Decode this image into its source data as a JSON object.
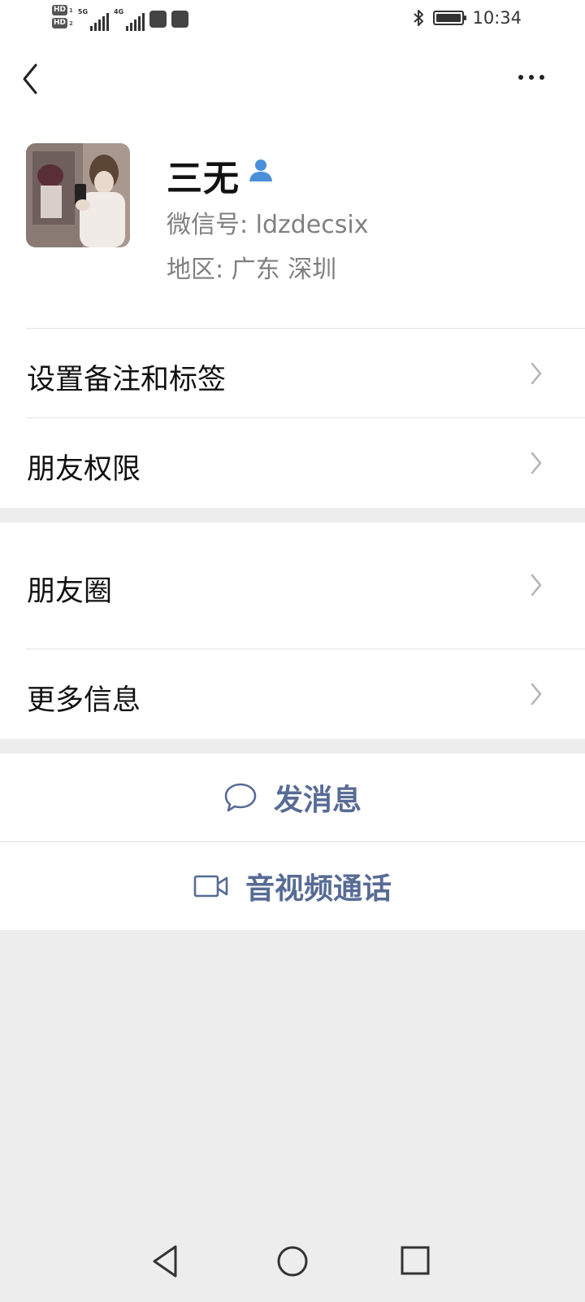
{
  "status_bar": {
    "network_badges": [
      "HD",
      "HD"
    ],
    "sim_labels": [
      "1",
      "2"
    ],
    "signal_1": "5G",
    "signal_2": "4G",
    "time": "10:34",
    "icons": [
      "bluetooth-icon",
      "battery-icon"
    ]
  },
  "header": {
    "back_icon": "chevron-left-icon",
    "more_icon": "more-dots-icon"
  },
  "profile": {
    "name": "三无",
    "wechat_id": "微信号: ldzdecsix",
    "region": "地区: 广东  深圳"
  },
  "menu": {
    "remarks_tags": "设置备注和标签",
    "friend_permissions": "朋友权限",
    "moments": "朋友圈",
    "more_info": "更多信息"
  },
  "actions": {
    "send_message": "发消息",
    "video_call": "音视频通话"
  },
  "colors": {
    "link": "#576b95",
    "background": "#ededed",
    "verified": "#4a90d9"
  }
}
